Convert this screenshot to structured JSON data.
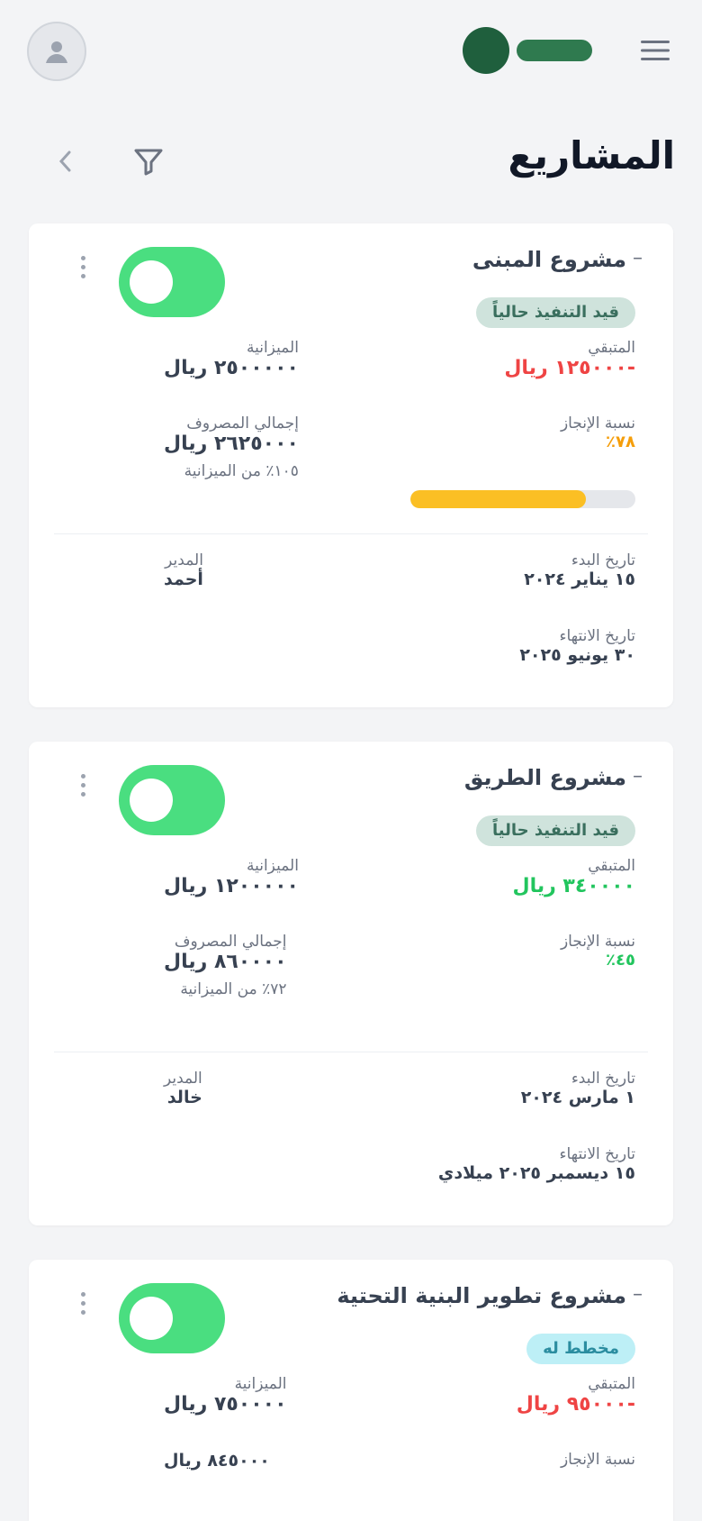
{
  "page": {
    "title": "المشاريع"
  },
  "colors": {
    "background": "#f3f4f6",
    "brand": "#1f5f3d",
    "toggle_on": "#4ade80",
    "danger": "#ef4444",
    "success": "#22c55e",
    "warning": "#fbbf24"
  },
  "icons": {
    "header_left": "user-avatar-icon",
    "header_right": "hamburger-menu-icon",
    "filter": "filter-icon",
    "back": "chevron-left-icon",
    "card_menu": "vertical-dots-icon"
  },
  "projects": [
    {
      "title": "مشروع المبنى",
      "status": "قيد التنفيذ حالياً",
      "remaining_label": "المتبقي",
      "remaining_value": "-١٢٥٠٠٠ ريال",
      "budget_label": "الميزانية",
      "budget_value": "٢٥٠٠٠٠٠ ريال",
      "progress_label": "نسبة الإنجاز",
      "progress_value": "٧٨٪",
      "progress": 0.78,
      "spent_label": "إجمالي المصروف",
      "spent_value": "٢٦٢٥٠٠٠ ريال",
      "spent_note": "١٠٥٪ من الميزانية",
      "start_label": "تاريخ البدء",
      "start_value": "١٥ يناير ٢٠٢٤",
      "end_label": "تاريخ الانتهاء",
      "end_value": "٣٠ يونيو ٢٠٢٥",
      "manager_label": "المدير",
      "manager_value": "أحمد"
    },
    {
      "title": "مشروع الطريق",
      "status": "قيد التنفيذ حالياً",
      "remaining_label": "المتبقي",
      "remaining_value": "٣٤٠٠٠٠ ريال",
      "budget_label": "الميزانية",
      "budget_value": "١٢٠٠٠٠٠ ريال",
      "progress_label": "نسبة الإنجاز",
      "progress_value": "٤٥٪",
      "progress": 0.45,
      "spent_label": "إجمالي المصروف",
      "spent_value": "٨٦٠٠٠٠ ريال",
      "spent_note": "٧٢٪ من الميزانية",
      "start_label": "تاريخ البدء",
      "start_value": "١ مارس ٢٠٢٤",
      "end_label": "تاريخ الانتهاء",
      "end_value": "١٥ ديسمبر ٢٠٢٥ ميلادي",
      "manager_label": "المدير",
      "manager_value": "خالد"
    },
    {
      "title": "مشروع تطوير البنية التحتية",
      "status": "مخطط له",
      "remaining_label": "المتبقي",
      "remaining_value": "-٩٥٠٠٠ ريال",
      "budget_label": "الميزانية",
      "budget_value": "٧٥٠٠٠٠ ريال",
      "progress_label": "نسبة الإنجاز",
      "progress_value": "",
      "spent_label": "",
      "spent_value": "٨٤٥٠٠٠ ريال"
    }
  ]
}
